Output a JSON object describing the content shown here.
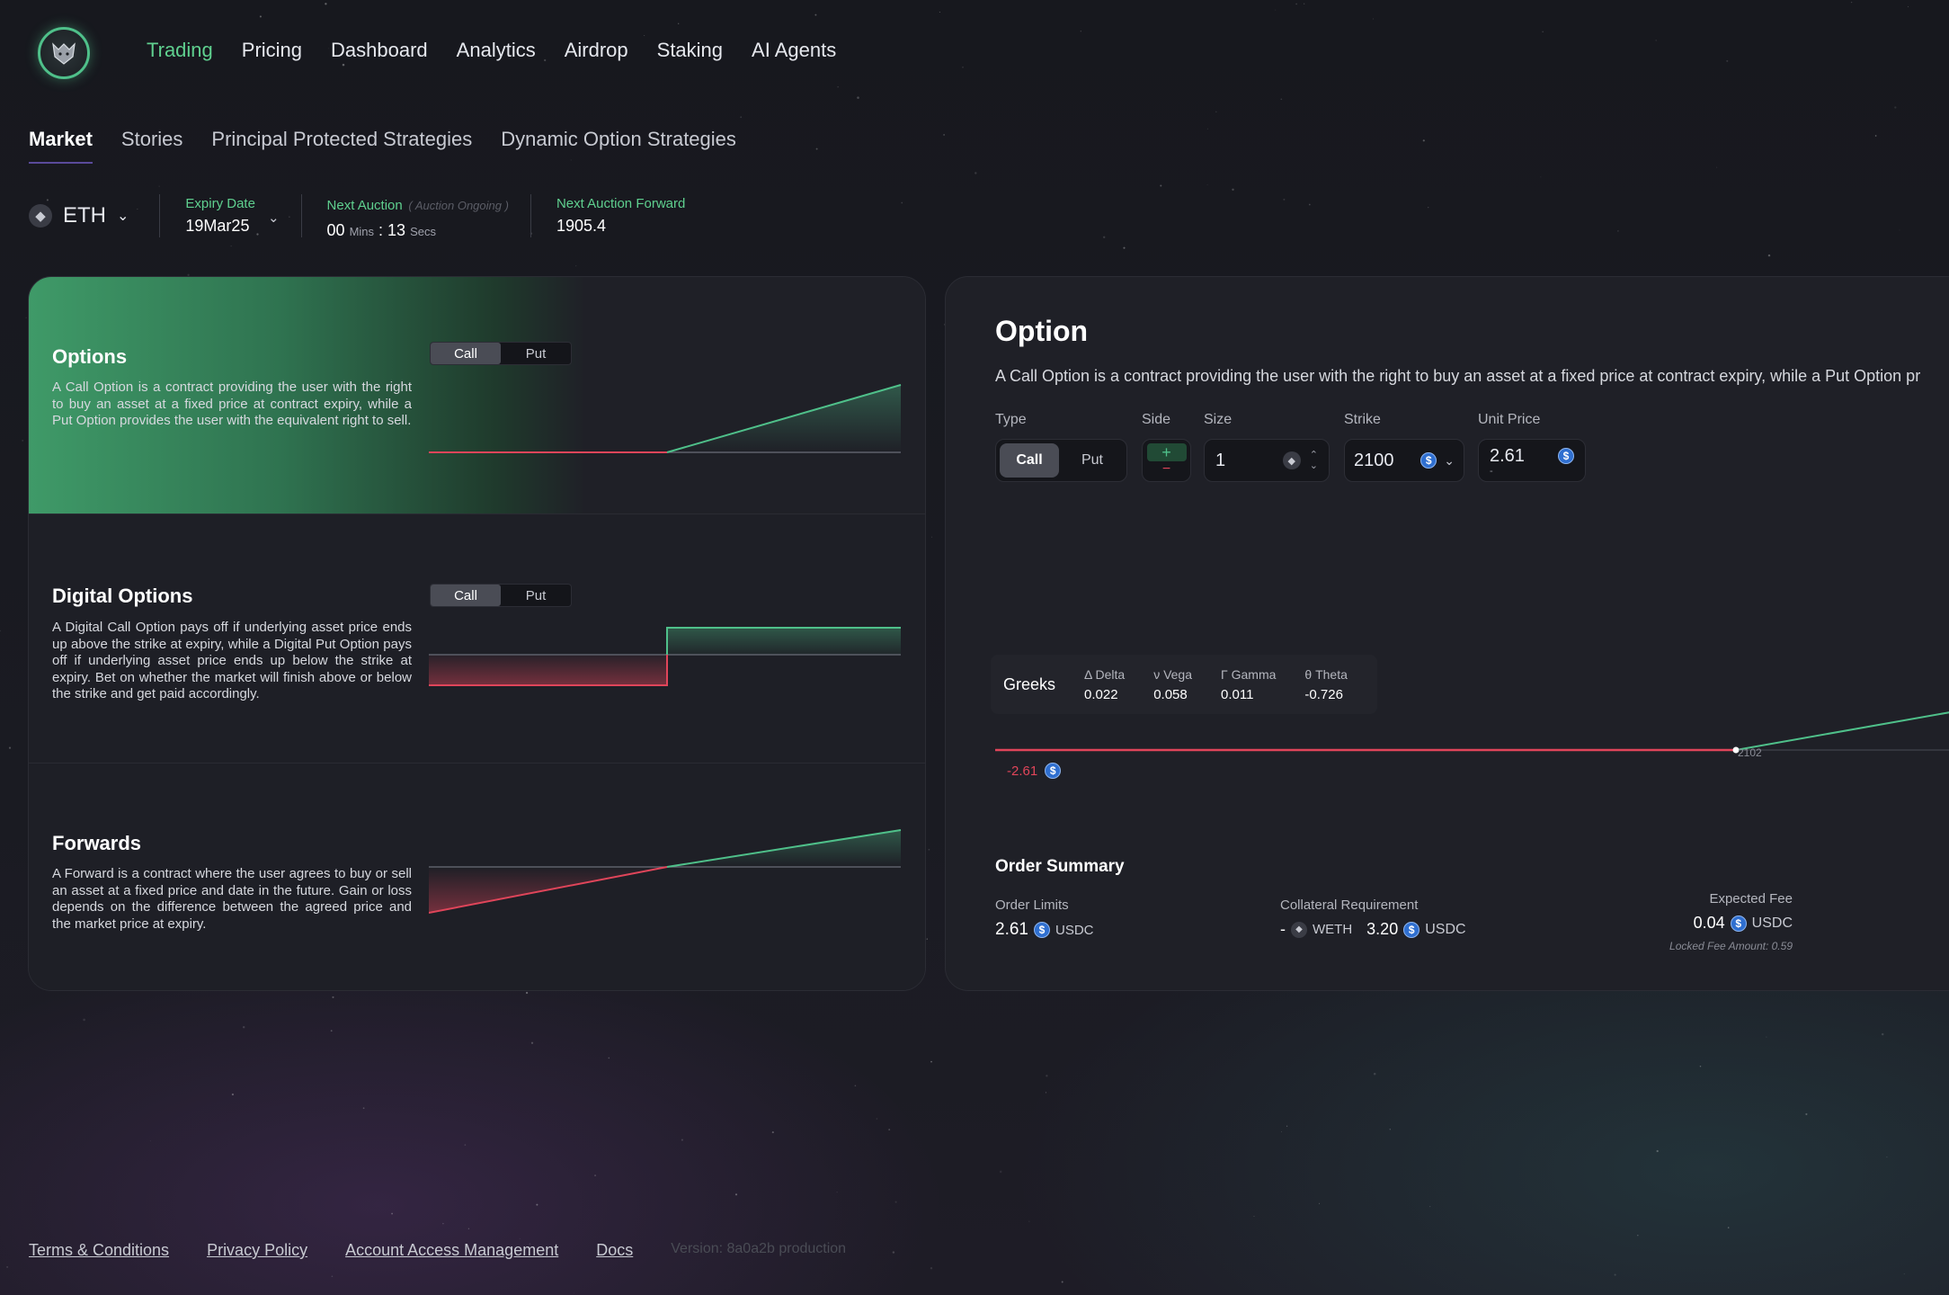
{
  "nav": {
    "items": [
      "Trading",
      "Pricing",
      "Dashboard",
      "Analytics",
      "Airdrop",
      "Staking",
      "AI Agents"
    ]
  },
  "tabs": [
    "Market",
    "Stories",
    "Principal Protected Strategies",
    "Dynamic Option Strategies"
  ],
  "asset": {
    "symbol": "ETH",
    "expiry_label": "Expiry Date",
    "expiry_value": "19Mar25",
    "auction_label": "Next Auction",
    "auction_status": "( Auction Ongoing )",
    "auction_mins": "00",
    "mins_unit": "Mins",
    "auction_secs": "13",
    "secs_unit": "Secs",
    "forward_label": "Next Auction Forward",
    "forward_value": "1905.4"
  },
  "products": [
    {
      "title": "Options",
      "description": "A Call Option is a contract providing the user with the right to buy an asset at a fixed price at contract expiry, while a Put Option provides the user with the equivalent right to sell.",
      "toggle": [
        "Call",
        "Put"
      ]
    },
    {
      "title": "Digital Options",
      "description": "A Digital Call Option pays off if underlying asset price ends up above the strike at expiry, while a Digital Put Option pays off if underlying asset price ends up below the strike at expiry. Bet on whether the market will finish above or below the strike and get paid accordingly.",
      "toggle": [
        "Call",
        "Put"
      ]
    },
    {
      "title": "Forwards",
      "description": "A Forward is a contract where the user agrees to buy or sell an asset at a fixed price and date in the future. Gain or loss depends on the difference between the agreed price and the market price at expiry."
    }
  ],
  "option": {
    "title": "Option",
    "description": "A Call Option is a contract providing the user with the right to buy an asset at a fixed price at contract expiry, while a Put Option pr",
    "labels": {
      "type": "Type",
      "side": "Side",
      "size": "Size",
      "strike": "Strike",
      "unit_price": "Unit Price"
    },
    "type_options": [
      "Call",
      "Put"
    ],
    "side_plus": "+",
    "side_minus": "−",
    "size_value": "1",
    "strike_value": "2100",
    "unit_price_value": "2.61",
    "unit_price_sub": "-",
    "greeks_label": "Greeks",
    "greeks": [
      {
        "name": "Δ Delta",
        "value": "0.022"
      },
      {
        "name": "ν Vega",
        "value": "0.058"
      },
      {
        "name": "Γ Gamma",
        "value": "0.011"
      },
      {
        "name": "θ Theta",
        "value": "-0.726"
      }
    ],
    "payoff_min": "-2.61",
    "payoff_mark": "2102"
  },
  "order_summary": {
    "title": "Order Summary",
    "order_limits_label": "Order Limits",
    "order_limits_value": "2.61",
    "order_limits_unit": "USDC",
    "collateral_label": "Collateral Requirement",
    "collateral_weth": "-",
    "weth_unit": "WETH",
    "collateral_usdc": "3.20",
    "usdc_unit": "USDC",
    "fee_label": "Expected Fee",
    "fee_value": "0.04",
    "fee_unit": "USDC",
    "locked_fee": "Locked Fee Amount: 0.59"
  },
  "footer": {
    "links": [
      "Terms & Conditions",
      "Privacy Policy",
      "Account Access Management",
      "Docs"
    ],
    "version": "Version: 8a0a2b production"
  },
  "colors": {
    "accent": "#5fd08f",
    "loss": "#e0455a",
    "usdc": "#2f6fd0"
  }
}
